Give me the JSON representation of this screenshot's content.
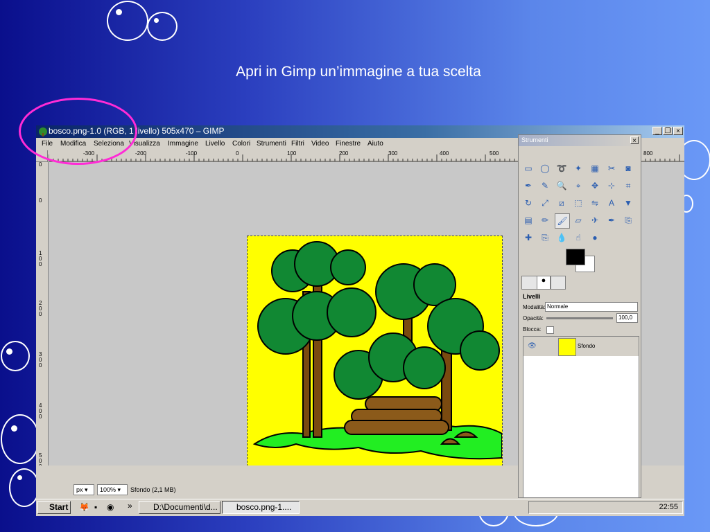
{
  "slide": {
    "title": "Apri in Gimp un’immagine a tua scelta"
  },
  "window": {
    "title": "bosco.png-1.0 (RGB, 1 livello) 505x470 – GIMP",
    "controls": [
      "_",
      "❐",
      "×"
    ]
  },
  "menu": [
    "File",
    "Modifica",
    "Seleziona",
    "Visualizza",
    "Immagine",
    "Livello",
    "Colori",
    "Strumenti",
    "Filtri",
    "Video",
    "Finestre",
    "Aiuto"
  ],
  "ruler": {
    "h_ticks": [
      "-300",
      "-200",
      "-100",
      "0",
      "100",
      "200",
      "300",
      "400",
      "500",
      "800"
    ],
    "v_ticks": [
      "0",
      "0",
      "100",
      "200",
      "300",
      "400",
      "500"
    ]
  },
  "status": {
    "unit": "px",
    "zoom": "100",
    "zoom_unit": "%",
    "info": "Sfondo (2,1 MB)"
  },
  "toolbox": {
    "title": "Strumenti",
    "tools": [
      "rect-select-icon",
      "ellipse-select-icon",
      "lasso-icon",
      "fuzzy-select-icon",
      "color-select-icon",
      "scissors-icon",
      "foreground-select-icon",
      "paths-icon",
      "color-picker-icon",
      "zoom-icon",
      "measure-icon",
      "move-icon",
      "align-icon",
      "crop-icon",
      "rotate-icon",
      "scale-icon",
      "shear-icon",
      "perspective-icon",
      "flip-icon",
      "text-icon",
      "bucket-fill-icon",
      "blend-icon",
      "pencil-icon",
      "paintbrush-icon",
      "eraser-icon",
      "airbrush-icon",
      "ink-icon",
      "clone-icon",
      "heal-icon",
      "perspective-clone-icon",
      "blur-icon",
      "smudge-icon",
      "dodge-burn-icon"
    ],
    "fg_color": "#000000",
    "bg_color": "#ffffff"
  },
  "layers": {
    "panel_title": "Livelli",
    "mode_label": "Modalità:",
    "mode_value": "Normale",
    "opacity_label": "Opacità:",
    "opacity_value": "100,0",
    "lock_label": "Blocca:",
    "layer_name": "Sfondo"
  },
  "taskbar": {
    "start": "Start",
    "chevron": "»",
    "task1": "D:\\Documenti\\d...",
    "task2": "bosco.png-1....",
    "clock": "22:55"
  }
}
